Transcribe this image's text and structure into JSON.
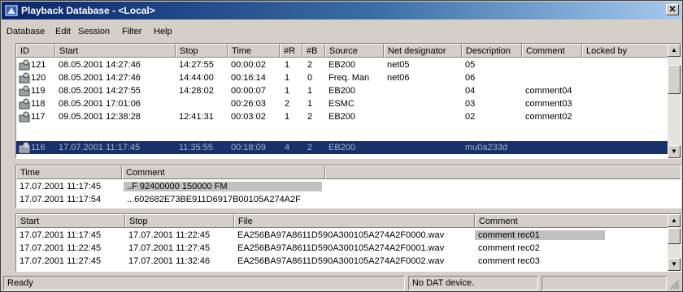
{
  "window": {
    "title": "Playback Database - <Local>",
    "close_glyph": "✕"
  },
  "menu": [
    "Database",
    "Edit",
    "Session",
    "Filter",
    "Help"
  ],
  "recordings": {
    "columns": [
      "ID",
      "Start",
      "Stop",
      "Time",
      "#R",
      "#B",
      "Source",
      "Net designator",
      "Description",
      "Comment",
      "Locked by"
    ],
    "rows": [
      {
        "id": "121",
        "start": "08.05.2001 14:27:46",
        "stop": "14:27:55",
        "time": "00:00:02",
        "r": "1",
        "b": "2",
        "source": "EB200",
        "net": "net05",
        "desc": "05",
        "comment": "",
        "locked": ""
      },
      {
        "id": "120",
        "start": "08.05.2001 14:27:46",
        "stop": "14:44:00",
        "time": "00:16:14",
        "r": "1",
        "b": "0",
        "source": "Freq. Man",
        "net": "net06",
        "desc": "06",
        "comment": "",
        "locked": ""
      },
      {
        "id": "119",
        "start": "08.05.2001 14:27:55",
        "stop": "14:28:02",
        "time": "00:00:07",
        "r": "1",
        "b": "1",
        "source": "EB200",
        "net": "",
        "desc": "04",
        "comment": "comment04",
        "locked": ""
      },
      {
        "id": "118",
        "start": "08.05.2001 17:01:06",
        "stop": "",
        "time": "00:26:03",
        "r": "2",
        "b": "1",
        "source": "ESMC",
        "net": "",
        "desc": "03",
        "comment": "comment03",
        "locked": ""
      },
      {
        "id": "117",
        "start": "09.05.2001 12:38:28",
        "stop": "12:41:31",
        "time": "00:03:02",
        "r": "1",
        "b": "2",
        "source": "EB200",
        "net": "",
        "desc": "02",
        "comment": "comment02",
        "locked": ""
      },
      {
        "id": "116",
        "start": "17.07.2001 11:17:45",
        "stop": "11:35:55",
        "time": "00:18:09",
        "r": "4",
        "b": "2",
        "source": "EB200",
        "net": "",
        "desc": "mu0a233d",
        "comment": "",
        "locked": ""
      }
    ]
  },
  "comments": {
    "columns": [
      "Time",
      "Comment"
    ],
    "rows": [
      {
        "time": "17.07.2001 11:17:45",
        "comment": "..F 92400000 150000 FM"
      },
      {
        "time": "17.07.2001 11:17:54",
        "comment": "...602682E73BE911D6917B00105A274A2F"
      }
    ]
  },
  "files": {
    "columns": [
      "Start",
      "Stop",
      "File",
      "Comment"
    ],
    "rows": [
      {
        "start": "17.07.2001 11:17:45",
        "stop": "17.07.2001 11:22:45",
        "file": "EA256BA97A8611D590A300105A274A2F0000.wav",
        "comment": "comment rec01"
      },
      {
        "start": "17.07.2001 11:22:45",
        "stop": "17.07.2001 11:27:45",
        "file": "EA256BA97A8611D590A300105A274A2F0001.wav",
        "comment": "comment rec02"
      },
      {
        "start": "17.07.2001 11:27:45",
        "stop": "17.07.2001 11:32:46",
        "file": "EA256BA97A8611D590A300105A274A2F0002.wav",
        "comment": "comment rec03"
      }
    ]
  },
  "status": {
    "left": "Ready",
    "device": "No DAT device."
  },
  "icons": {
    "up": "▲",
    "down": "▼",
    "record": "recording-icon",
    "app": "app-icon"
  }
}
